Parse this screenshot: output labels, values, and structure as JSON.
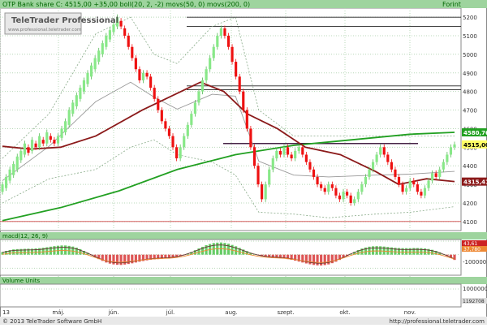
{
  "header": {
    "title": "OTP Bank share  C: 4515,00 +35,00 boll(20, 2, -2) movs(50, 0) movs(200, 0)",
    "unit": "Forint",
    "logo_line1": "TeleTrader Professional",
    "logo_line2": "www.professional.teletrader.com"
  },
  "macd": {
    "label": "macd(12, 26, 9)",
    "tick_top": "100000",
    "tick_bottom": "-100000",
    "macd_value": "43,61",
    "signal_value": "37,780"
  },
  "volume": {
    "label": "Volume Units",
    "tick": "1000000",
    "last_value": "1192708"
  },
  "footer": {
    "copyright": "© 2013 TeleTrader Software GmbH",
    "url": "http://professional.teletrader.com"
  },
  "colors": {
    "background": "#ffffff",
    "up_candle": "#88e888",
    "down_candle": "#ee1111",
    "ma50": "#8b1a1a",
    "ma200": "#22a022",
    "bollinger": "#999999",
    "grid": "#b8d8b8",
    "header_bar": "#9ed49e",
    "title_text": "#006600"
  },
  "chart_data": [
    {
      "type": "candlestick",
      "title": "OTP Bank share",
      "close": 4515,
      "change": 35,
      "x_tick_labels": [
        "13",
        "máj.",
        "jún.",
        "júl.",
        "aug.",
        "szept.",
        "okt.",
        "nov."
      ],
      "y_tick_labels": [
        4100,
        4200,
        4300,
        4400,
        4500,
        4600,
        4700,
        4800,
        4900,
        5000,
        5100,
        5200
      ],
      "ylim": [
        4060,
        5240
      ],
      "grid": true,
      "horizontal_lines": [
        5200,
        5150,
        4830,
        4810,
        4520,
        4100
      ],
      "labels": {
        "ma200": "4580,76",
        "close": "4515,00",
        "ma50": "4315,41"
      },
      "series": [
        {
          "name": "movs(50, 0)",
          "x": [
            0,
            12,
            25,
            40,
            60,
            75,
            85,
            95,
            105,
            118,
            130,
            145,
            160,
            170,
            182,
            194
          ],
          "values": [
            4505,
            4490,
            4500,
            4560,
            4700,
            4790,
            4850,
            4800,
            4680,
            4600,
            4500,
            4460,
            4370,
            4300,
            4330,
            4315
          ]
        },
        {
          "name": "movs(200, 0)",
          "x": [
            0,
            25,
            50,
            75,
            100,
            125,
            150,
            175,
            194
          ],
          "values": [
            4105,
            4175,
            4265,
            4380,
            4460,
            4510,
            4540,
            4570,
            4580
          ]
        }
      ],
      "bollinger_upper": {
        "x": [
          0,
          20,
          40,
          55,
          65,
          75,
          90,
          100,
          110,
          125,
          140,
          160,
          175,
          194
        ],
        "values": [
          4440,
          4680,
          5110,
          5200,
          5000,
          4950,
          5150,
          5200,
          4700,
          4560,
          4560,
          4560,
          4560,
          4560
        ]
      },
      "bollinger_lower": {
        "x": [
          0,
          20,
          40,
          55,
          65,
          75,
          90,
          100,
          110,
          125,
          140,
          160,
          175,
          194
        ],
        "values": [
          4200,
          4330,
          4380,
          4500,
          4540,
          4460,
          4420,
          4350,
          4150,
          4140,
          4120,
          4140,
          4150,
          4180
        ]
      },
      "bollinger_mid": {
        "x": [
          0,
          20,
          40,
          55,
          65,
          75,
          90,
          100,
          110,
          125,
          140,
          160,
          175,
          194
        ],
        "values": [
          4320,
          4505,
          4745,
          4850,
          4770,
          4705,
          4785,
          4775,
          4425,
          4350,
          4340,
          4350,
          4355,
          4370
        ]
      },
      "candles": [
        [
          4260,
          4300
        ],
        [
          4280,
          4340
        ],
        [
          4320,
          4380
        ],
        [
          4350,
          4410
        ],
        [
          4380,
          4450
        ],
        [
          4430,
          4480
        ],
        [
          4460,
          4520
        ],
        [
          4500,
          4470
        ],
        [
          4480,
          4540
        ],
        [
          4520,
          4500
        ],
        [
          4500,
          4560
        ],
        [
          4540,
          4520
        ],
        [
          4520,
          4580
        ],
        [
          4560,
          4540
        ],
        [
          4540,
          4520
        ],
        [
          4520,
          4560
        ],
        [
          4550,
          4600
        ],
        [
          4580,
          4640
        ],
        [
          4620,
          4700
        ],
        [
          4680,
          4740
        ],
        [
          4720,
          4780
        ],
        [
          4760,
          4820
        ],
        [
          4800,
          4860
        ],
        [
          4840,
          4900
        ],
        [
          4880,
          4940
        ],
        [
          4920,
          4980
        ],
        [
          4960,
          5020
        ],
        [
          5000,
          5060
        ],
        [
          5040,
          5100
        ],
        [
          5080,
          5130
        ],
        [
          5120,
          5160
        ],
        [
          5150,
          5200
        ],
        [
          5180,
          5150
        ],
        [
          5140,
          5100
        ],
        [
          5100,
          5040
        ],
        [
          5040,
          4980
        ],
        [
          4980,
          4920
        ],
        [
          4920,
          4860
        ],
        [
          4860,
          4900
        ],
        [
          4900,
          4880
        ],
        [
          4880,
          4820
        ],
        [
          4820,
          4760
        ],
        [
          4760,
          4700
        ],
        [
          4700,
          4640
        ],
        [
          4640,
          4600
        ],
        [
          4600,
          4560
        ],
        [
          4560,
          4500
        ],
        [
          4500,
          4440
        ],
        [
          4440,
          4500
        ],
        [
          4500,
          4560
        ],
        [
          4560,
          4620
        ],
        [
          4620,
          4680
        ],
        [
          4680,
          4740
        ],
        [
          4740,
          4800
        ],
        [
          4800,
          4860
        ],
        [
          4860,
          4920
        ],
        [
          4920,
          4980
        ],
        [
          4980,
          5040
        ],
        [
          5040,
          5100
        ],
        [
          5100,
          5140
        ],
        [
          5140,
          5100
        ],
        [
          5100,
          5040
        ],
        [
          5040,
          4960
        ],
        [
          4960,
          4880
        ],
        [
          4880,
          4800
        ],
        [
          4800,
          4700
        ],
        [
          4700,
          4600
        ],
        [
          4600,
          4500
        ],
        [
          4500,
          4400
        ],
        [
          4400,
          4300
        ],
        [
          4300,
          4220
        ],
        [
          4220,
          4300
        ],
        [
          4300,
          4380
        ],
        [
          4380,
          4440
        ],
        [
          4440,
          4480
        ],
        [
          4480,
          4460
        ],
        [
          4460,
          4500
        ],
        [
          4500,
          4460
        ],
        [
          4460,
          4440
        ],
        [
          4440,
          4480
        ],
        [
          4480,
          4500
        ],
        [
          4500,
          4460
        ],
        [
          4460,
          4420
        ],
        [
          4420,
          4380
        ],
        [
          4380,
          4340
        ],
        [
          4340,
          4300
        ],
        [
          4300,
          4280
        ],
        [
          4280,
          4260
        ],
        [
          4260,
          4300
        ],
        [
          4300,
          4280
        ],
        [
          4280,
          4240
        ],
        [
          4240,
          4220
        ],
        [
          4220,
          4260
        ],
        [
          4260,
          4240
        ],
        [
          4240,
          4200
        ],
        [
          4200,
          4220
        ],
        [
          4220,
          4260
        ],
        [
          4260,
          4300
        ],
        [
          4300,
          4340
        ],
        [
          4340,
          4380
        ],
        [
          4380,
          4420
        ],
        [
          4420,
          4460
        ],
        [
          4460,
          4500
        ],
        [
          4500,
          4460
        ],
        [
          4460,
          4420
        ],
        [
          4420,
          4380
        ],
        [
          4380,
          4340
        ],
        [
          4340,
          4300
        ],
        [
          4300,
          4260
        ],
        [
          4260,
          4280
        ],
        [
          4280,
          4320
        ],
        [
          4320,
          4300
        ],
        [
          4300,
          4260
        ],
        [
          4260,
          4240
        ],
        [
          4240,
          4280
        ],
        [
          4280,
          4320
        ],
        [
          4320,
          4360
        ],
        [
          4360,
          4340
        ],
        [
          4340,
          4380
        ],
        [
          4380,
          4420
        ],
        [
          4420,
          4460
        ],
        [
          4460,
          4500
        ],
        [
          4500,
          4515
        ]
      ]
    },
    {
      "type": "macd",
      "title": "macd(12, 26, 9)",
      "ylim": [
        -140,
        100
      ]
    },
    {
      "type": "bar",
      "title": "Volume Units"
    }
  ]
}
